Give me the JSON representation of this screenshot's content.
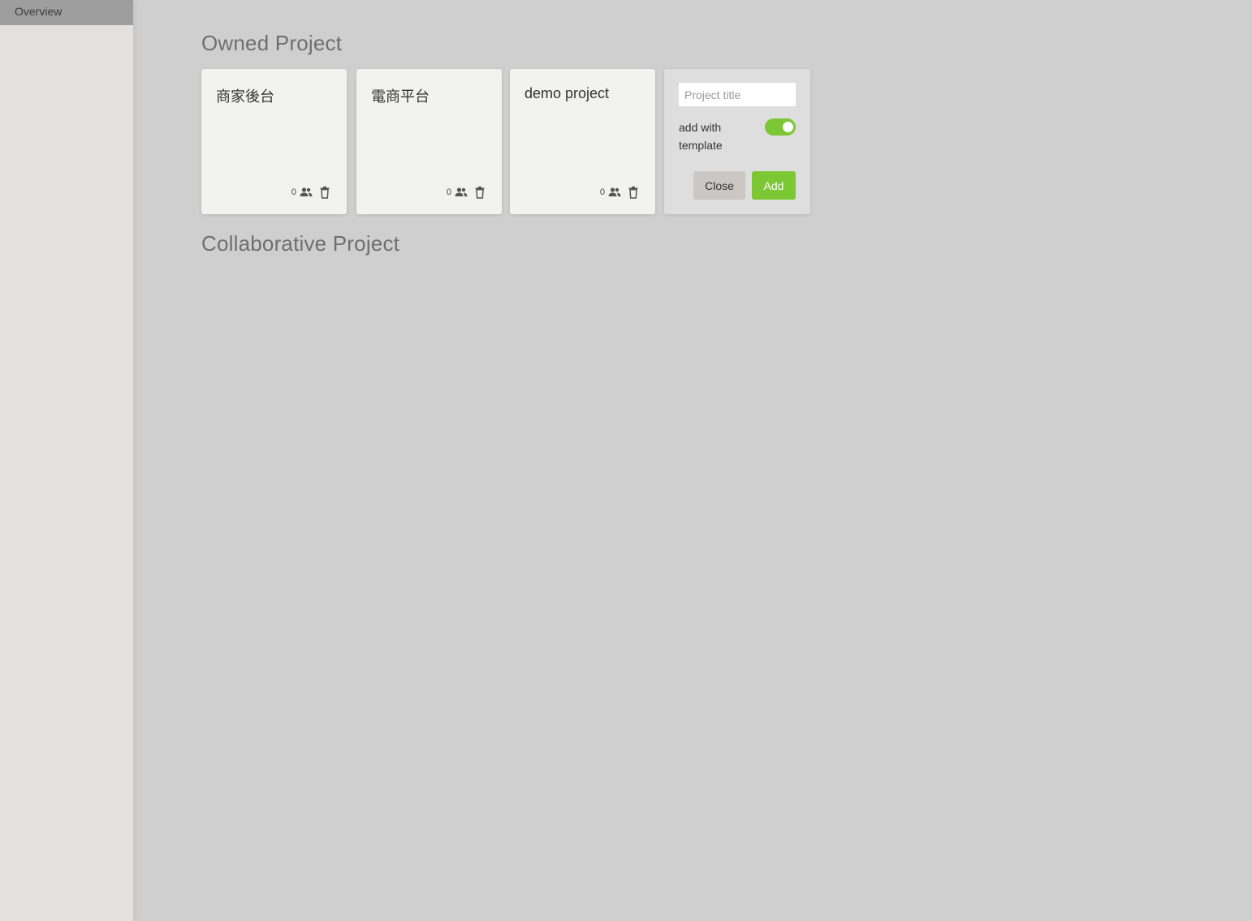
{
  "sidebar": {
    "items": [
      {
        "label": "Overview",
        "active": true
      }
    ]
  },
  "sections": {
    "owned_title": "Owned Project",
    "collaborative_title": "Collaborative Project"
  },
  "projects": [
    {
      "title": "商家後台",
      "member_count": "0"
    },
    {
      "title": "電商平台",
      "member_count": "0"
    },
    {
      "title": "demo project",
      "member_count": "0"
    }
  ],
  "new_project_form": {
    "title_value": "",
    "title_placeholder": "Project title",
    "template_label": "add with template",
    "template_enabled": true,
    "close_label": "Close",
    "add_label": "Add"
  },
  "colors": {
    "accent_green": "#7cc734",
    "background": "#cfcfcf",
    "sidebar_bg": "#e2e1df",
    "sidebar_active": "#9e9e9e"
  },
  "icons": {
    "members": "people-icon",
    "delete": "trash-icon"
  }
}
